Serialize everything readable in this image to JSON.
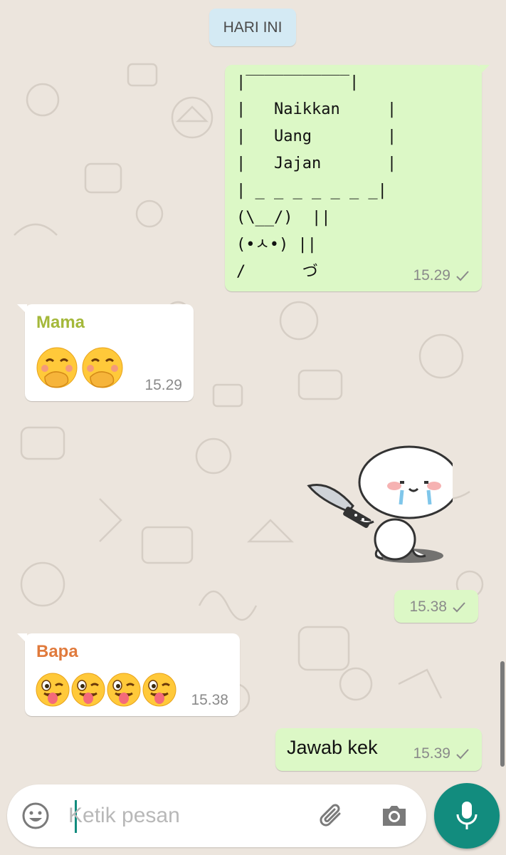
{
  "chat": {
    "date_pill": "HARI INI",
    "messages": [
      {
        "direction": "out",
        "text": "|‾‾‾‾‾‾‾‾‾‾‾|\n|   Naikkan     |\n|   Uang        |\n|   Jajan       |\n| _ _ _ _ _ _ _|\n(\\__/)  ||\n(•ㅅ•) ||\n/      づ",
        "time": "15.29",
        "status": "sent"
      },
      {
        "direction": "in",
        "sender": "Mama",
        "sender_color": "#a4b83a",
        "emojis": [
          "face-with-hand-over-mouth",
          "face-with-hand-over-mouth"
        ],
        "time": "15.29"
      },
      {
        "direction": "out",
        "type": "sticker",
        "sticker": "crying-bun-with-knife",
        "time": "15.38",
        "status": "sent"
      },
      {
        "direction": "in",
        "sender": "Bapa",
        "sender_color": "#e07a3c",
        "emojis": [
          "winking-face-with-tongue",
          "winking-face-with-tongue",
          "winking-face-with-tongue",
          "winking-face-with-tongue"
        ],
        "time": "15.38"
      },
      {
        "direction": "out",
        "text": "Jawab kek",
        "time": "15.39",
        "status": "sent"
      }
    ]
  },
  "composer": {
    "placeholder": "Ketik pesan",
    "icons": [
      "emoji-icon",
      "attach-icon",
      "camera-icon",
      "mic-icon"
    ]
  },
  "colors": {
    "outgoing_bubble": "#dcf8c6",
    "incoming_bubble": "#ffffff",
    "accent": "#128c7e",
    "background": "#ece5dd"
  }
}
